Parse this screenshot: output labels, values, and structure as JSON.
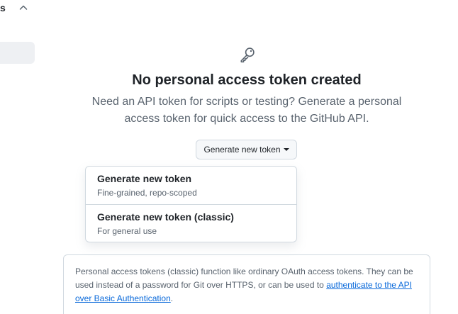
{
  "sidebar": {
    "header_label": "s",
    "chevron_icon": "chevron-up-icon"
  },
  "blankslate": {
    "icon": "key-icon",
    "title": "No personal access token created",
    "description_line1": "Need an API token for scripts or testing? Generate a personal",
    "description_line2": "access token for quick access to the GitHub API."
  },
  "generate_button": {
    "label": "Generate new token"
  },
  "menu": {
    "items": [
      {
        "title": "Generate new token",
        "subtitle": "Fine-grained, repo-scoped"
      },
      {
        "title": "Generate new token (classic)",
        "subtitle": "For general use"
      }
    ]
  },
  "info": {
    "text_before": "Personal access tokens (classic) function like ordinary OAuth access tokens. They can be used instead of a password for Git over HTTPS, or can be used to ",
    "link_text": "authenticate to the API over Basic Authentication",
    "text_after": "."
  },
  "colors": {
    "link": "#0969da",
    "muted_text": "#59636e",
    "border": "#d1d9e0"
  }
}
